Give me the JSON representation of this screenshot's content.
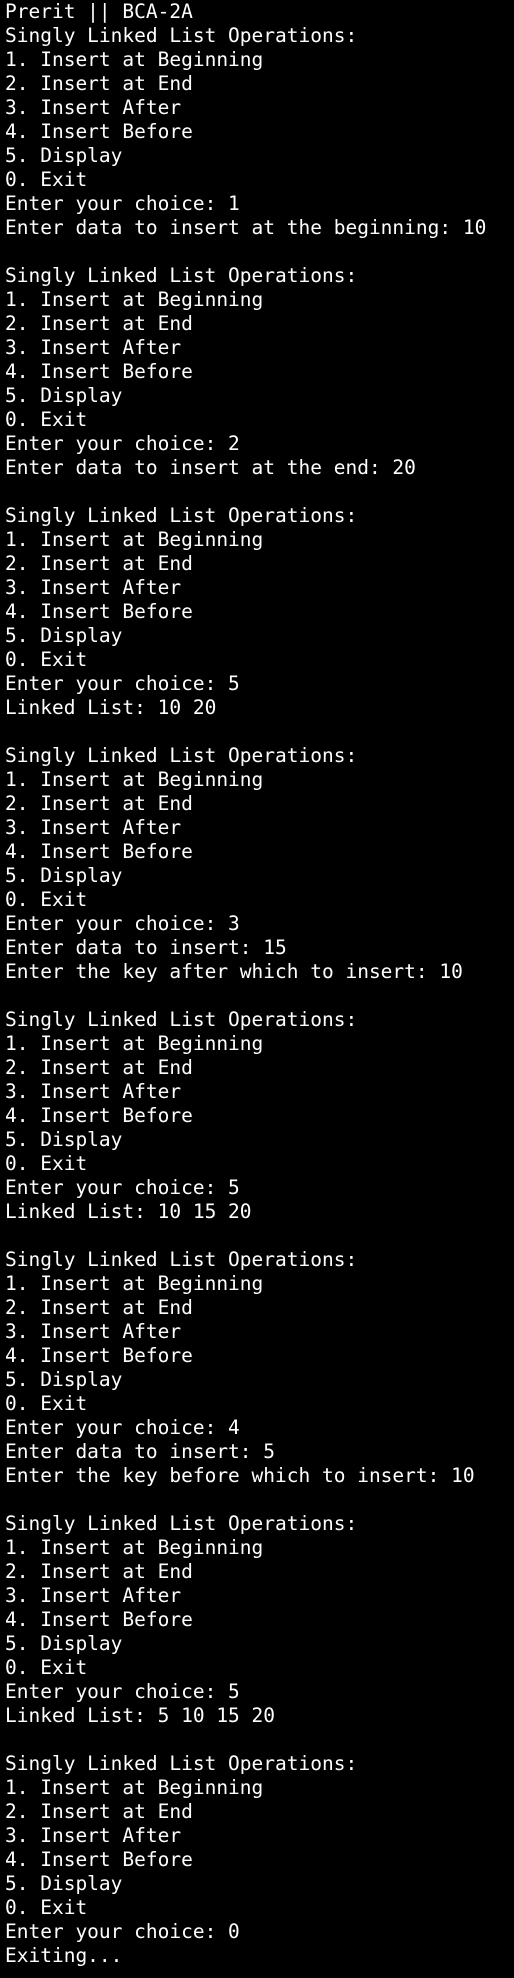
{
  "terminal": {
    "lines": [
      "Prerit || BCA-2A",
      "Singly Linked List Operations:",
      "1. Insert at Beginning",
      "2. Insert at End",
      "3. Insert After",
      "4. Insert Before",
      "5. Display",
      "0. Exit",
      "Enter your choice: 1",
      "Enter data to insert at the beginning: 10",
      "",
      "Singly Linked List Operations:",
      "1. Insert at Beginning",
      "2. Insert at End",
      "3. Insert After",
      "4. Insert Before",
      "5. Display",
      "0. Exit",
      "Enter your choice: 2",
      "Enter data to insert at the end: 20",
      "",
      "Singly Linked List Operations:",
      "1. Insert at Beginning",
      "2. Insert at End",
      "3. Insert After",
      "4. Insert Before",
      "5. Display",
      "0. Exit",
      "Enter your choice: 5",
      "Linked List: 10 20",
      "",
      "Singly Linked List Operations:",
      "1. Insert at Beginning",
      "2. Insert at End",
      "3. Insert After",
      "4. Insert Before",
      "5. Display",
      "0. Exit",
      "Enter your choice: 3",
      "Enter data to insert: 15",
      "Enter the key after which to insert: 10",
      "",
      "Singly Linked List Operations:",
      "1. Insert at Beginning",
      "2. Insert at End",
      "3. Insert After",
      "4. Insert Before",
      "5. Display",
      "0. Exit",
      "Enter your choice: 5",
      "Linked List: 10 15 20",
      "",
      "Singly Linked List Operations:",
      "1. Insert at Beginning",
      "2. Insert at End",
      "3. Insert After",
      "4. Insert Before",
      "5. Display",
      "0. Exit",
      "Enter your choice: 4",
      "Enter data to insert: 5",
      "Enter the key before which to insert: 10",
      "",
      "Singly Linked List Operations:",
      "1. Insert at Beginning",
      "2. Insert at End",
      "3. Insert After",
      "4. Insert Before",
      "5. Display",
      "0. Exit",
      "Enter your choice: 5",
      "Linked List: 5 10 15 20",
      "",
      "Singly Linked List Operations:",
      "1. Insert at Beginning",
      "2. Insert at End",
      "3. Insert After",
      "4. Insert Before",
      "5. Display",
      "0. Exit",
      "Enter your choice: 0",
      "Exiting..."
    ],
    "colors": {
      "background": "#000000",
      "foreground": "#ffffff"
    }
  }
}
